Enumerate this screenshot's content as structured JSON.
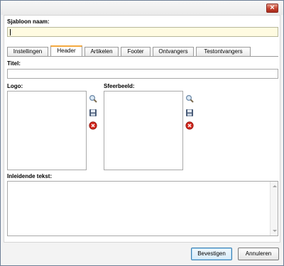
{
  "dialog": {
    "close_label": "×"
  },
  "name_field": {
    "label": "Sjabloon naam:",
    "value": ""
  },
  "tabs": [
    {
      "label": "Instellingen",
      "active": false
    },
    {
      "label": "Header",
      "active": true
    },
    {
      "label": "Artikelen",
      "active": false
    },
    {
      "label": "Footer",
      "active": false
    },
    {
      "label": "Ontvangers",
      "active": false
    },
    {
      "label": "Testontvangers",
      "active": false
    }
  ],
  "header_tab": {
    "title_label": "Titel:",
    "title_value": "",
    "logo_label": "Logo:",
    "sfeerbeeld_label": "Sfeerbeeld:",
    "intro_label": "Inleidende tekst:",
    "intro_value": ""
  },
  "icons": [
    "magnifier-icon",
    "save-icon",
    "delete-icon"
  ],
  "colors": {
    "name_field_bg": "#fffbe1",
    "active_tab_accent": "#f4a93f",
    "close_button": "#c4402c",
    "primary_button_border": "#3c7fb1"
  },
  "footer": {
    "confirm_label": "Bevestigen",
    "cancel_label": "Annuleren"
  }
}
